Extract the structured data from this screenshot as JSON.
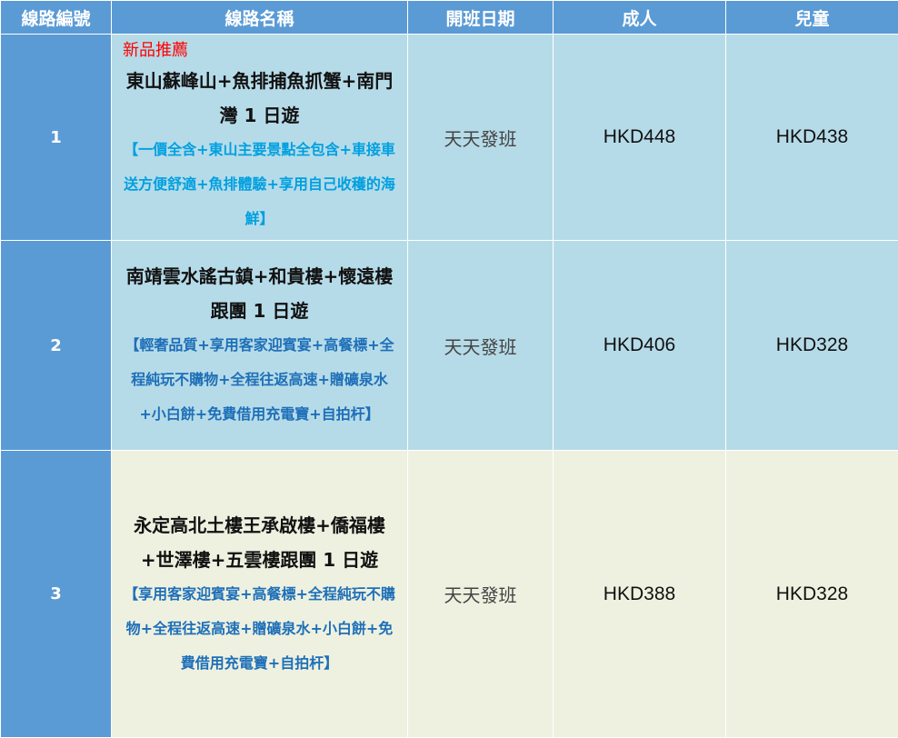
{
  "headers": {
    "route_no": "線路編號",
    "route_name": "線路名稱",
    "schedule": "開班日期",
    "adult": "成人",
    "child": "兒童"
  },
  "rows": [
    {
      "no": "1",
      "tag": "新品推薦",
      "title": "東山蘇峰山+魚排捕魚抓蟹+南門灣 1 日遊",
      "desc": "【一價全含+東山主要景點全包含+車接車送方便舒適+魚排體驗+享用自己收穫的海鮮】",
      "schedule": "天天發班",
      "adult": "HKD448",
      "child": "HKD438"
    },
    {
      "no": "2",
      "title": "南靖雲水謠古鎮+和貴樓+懷遠樓跟團 1 日遊",
      "desc": "【輕奢品質+享用客家迎賓宴+高餐標+全程純玩不購物+全程往返高速+贈礦泉水+小白餅+免費借用充電寶+自拍杆】",
      "schedule": "天天發班",
      "adult": "HKD406",
      "child": "HKD328"
    },
    {
      "no": "3",
      "title": "永定高北土樓王承啟樓+僑福樓+世澤樓+五雲樓跟團 1 日遊",
      "desc": "【享用客家迎賓宴+高餐標+全程純玩不購物+全程往返高速+贈礦泉水+小白餅+免費借用充電寶+自拍杆】",
      "schedule": "天天發班",
      "adult": "HKD388",
      "child": "HKD328"
    }
  ]
}
